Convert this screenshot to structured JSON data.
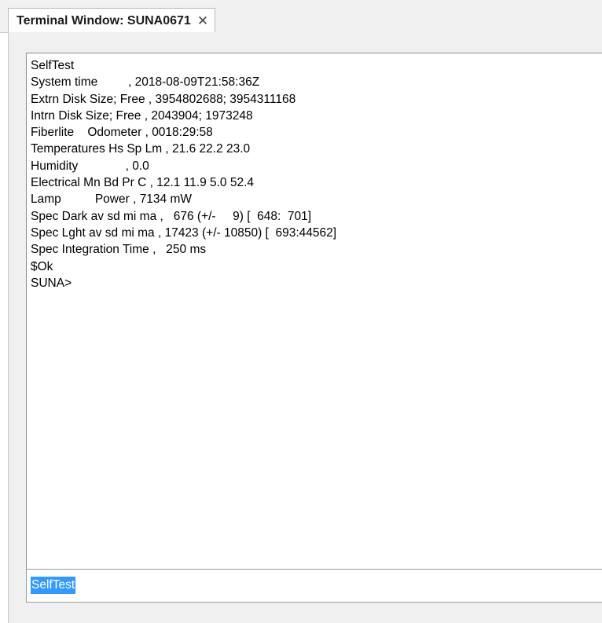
{
  "tab": {
    "title": "Terminal Window: SUNA0671",
    "close_glyph": "✕"
  },
  "terminal": {
    "lines": [
      "SelfTest",
      "System time         , 2018-08-09T21:58:36Z",
      "Extrn Disk Size; Free , 3954802688; 3954311168",
      "Intrn Disk Size; Free , 2043904; 1973248",
      "Fiberlite    Odometer , 0018:29:58",
      "Temperatures Hs Sp Lm , 21.6 22.2 23.0",
      "Humidity              , 0.0",
      "Electrical Mn Bd Pr C , 12.1 11.9 5.0 52.4",
      "Lamp          Power , 7134 mW",
      "Spec Dark av sd mi ma ,   676 (+/-     9) [  648:  701]",
      "Spec Lght av sd mi ma , 17423 (+/- 10850) [  693:44562]",
      "Spec Integration Time ,   250 ms",
      "$Ok",
      "SUNA>"
    ]
  },
  "command_input": {
    "value": "SelfTest",
    "selection_color": "#3399ff"
  }
}
